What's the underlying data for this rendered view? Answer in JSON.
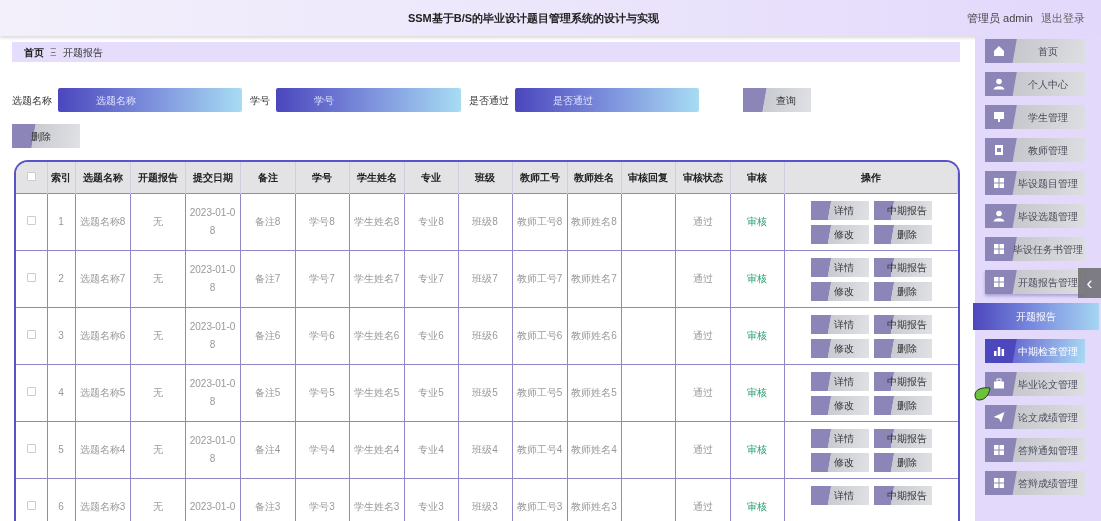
{
  "header": {
    "title": "SSM基于B/S的毕业设计题目管理系统的设计与实现",
    "user": "管理员 admin",
    "logout": "退出登录"
  },
  "breadcrumb": [
    "首页",
    "开题报告"
  ],
  "breadcrumb_separator": "Ξ",
  "search": {
    "fields": [
      {
        "label": "选题名称",
        "placeholder": "选题名称"
      },
      {
        "label": "学号",
        "placeholder": "学号"
      },
      {
        "label": "是否通过",
        "placeholder": "是否通过"
      }
    ],
    "button": "查询"
  },
  "delete_button": "删除",
  "table": {
    "header_checked": false,
    "columns": [
      "索引",
      "选题名称",
      "开题报告",
      "提交日期",
      "备注",
      "学号",
      "学生姓名",
      "专业",
      "班级",
      "教师工号",
      "教师姓名",
      "审核回复",
      "审核状态",
      "审核",
      "操作"
    ],
    "rows": [
      {
        "checked": false,
        "cells": [
          "1",
          "选题名称8",
          "无",
          "2023-01-08",
          "备注8",
          "学号8",
          "学生姓名8",
          "专业8",
          "班级8",
          "教师工号8",
          "教师姓名8",
          "",
          "通过"
        ],
        "review": "审核",
        "actions": [
          "详情",
          "中期报告",
          "修改",
          "删除"
        ]
      },
      {
        "checked": false,
        "cells": [
          "2",
          "选题名称7",
          "无",
          "2023-01-08",
          "备注7",
          "学号7",
          "学生姓名7",
          "专业7",
          "班级7",
          "教师工号7",
          "教师姓名7",
          "",
          "通过"
        ],
        "review": "审核",
        "actions": [
          "详情",
          "中期报告",
          "修改",
          "删除"
        ]
      },
      {
        "checked": false,
        "cells": [
          "3",
          "选题名称6",
          "无",
          "2023-01-08",
          "备注6",
          "学号6",
          "学生姓名6",
          "专业6",
          "班级6",
          "教师工号6",
          "教师姓名6",
          "",
          "通过"
        ],
        "review": "审核",
        "actions": [
          "详情",
          "中期报告",
          "修改",
          "删除"
        ]
      },
      {
        "checked": false,
        "cells": [
          "4",
          "选题名称5",
          "无",
          "2023-01-08",
          "备注5",
          "学号5",
          "学生姓名5",
          "专业5",
          "班级5",
          "教师工号5",
          "教师姓名5",
          "",
          "通过"
        ],
        "review": "审核",
        "actions": [
          "详情",
          "中期报告",
          "修改",
          "删除"
        ]
      },
      {
        "checked": false,
        "cells": [
          "5",
          "选题名称4",
          "无",
          "2023-01-08",
          "备注4",
          "学号4",
          "学生姓名4",
          "专业4",
          "班级4",
          "教师工号4",
          "教师姓名4",
          "",
          "通过"
        ],
        "review": "审核",
        "actions": [
          "详情",
          "中期报告",
          "修改",
          "删除"
        ]
      },
      {
        "checked": false,
        "cells": [
          "6",
          "选题名称3",
          "无",
          "2023-01-0",
          "备注3",
          "学号3",
          "学生姓名3",
          "专业3",
          "班级3",
          "教师工号3",
          "教师姓名3",
          "",
          "通过"
        ],
        "review": "审核",
        "actions": [
          "详情",
          "中期报告"
        ]
      }
    ]
  },
  "sidebar": {
    "items": [
      {
        "label": "首页",
        "kind": "home",
        "selected": false,
        "hovered": false
      },
      {
        "label": "个人中心",
        "kind": "user",
        "selected": false,
        "hovered": false
      },
      {
        "label": "学生管理",
        "kind": "monitor",
        "selected": false,
        "hovered": false
      },
      {
        "label": "教师管理",
        "kind": "clipboard",
        "selected": false,
        "hovered": false
      },
      {
        "label": "毕设题目管理",
        "kind": "grid",
        "selected": false,
        "hovered": false
      },
      {
        "label": "毕设选题管理",
        "kind": "user",
        "selected": false,
        "hovered": false
      },
      {
        "label": "毕设任务书管理",
        "kind": "grid",
        "selected": false,
        "hovered": false
      },
      {
        "label": "开题报告管理",
        "kind": "grid",
        "selected": false,
        "hovered": false,
        "expanded": true,
        "children": [
          {
            "label": "开题报告",
            "selected": true
          }
        ]
      },
      {
        "label": "中期检查管理",
        "kind": "chart",
        "selected": false,
        "hovered": true
      },
      {
        "label": "毕业论文管理",
        "kind": "briefcase",
        "selected": false,
        "hovered": false
      },
      {
        "label": "论文成绩管理",
        "kind": "plane",
        "selected": false,
        "hovered": false
      },
      {
        "label": "答辩通知管理",
        "kind": "grid",
        "selected": false,
        "hovered": false
      },
      {
        "label": "答辩成绩管理",
        "kind": "grid",
        "selected": false,
        "hovered": false
      }
    ]
  },
  "collapse_button": "‹"
}
